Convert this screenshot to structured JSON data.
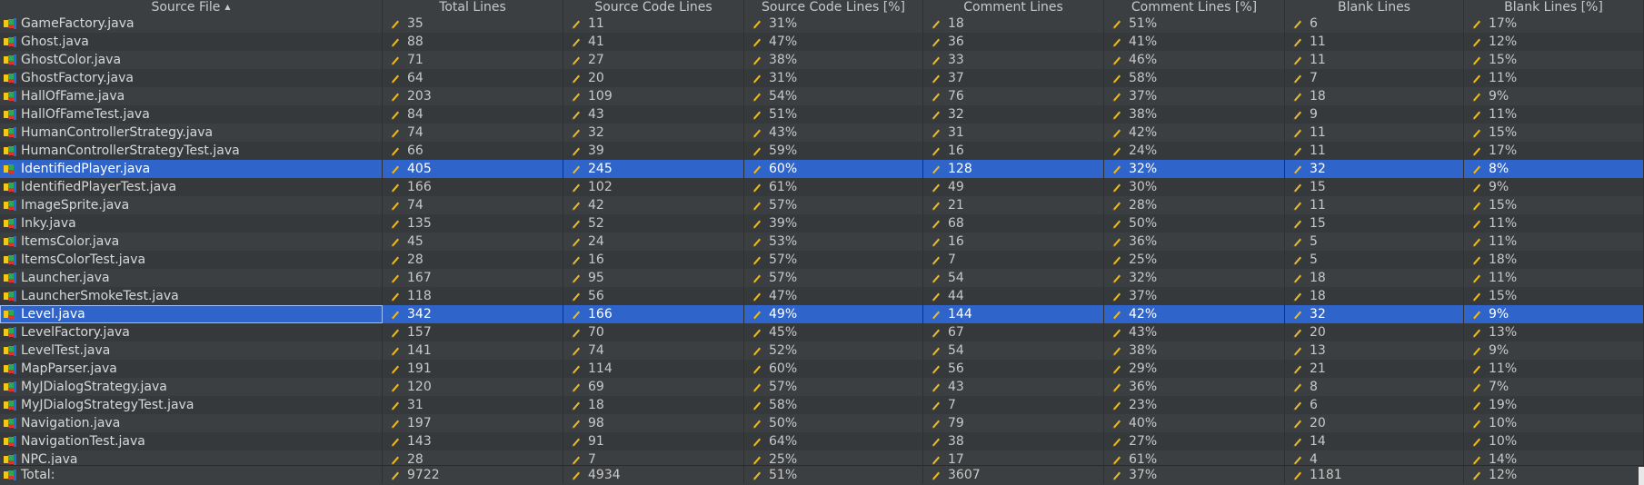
{
  "table": {
    "columns": [
      {
        "label": "Source File",
        "sorted": "asc"
      },
      {
        "label": "Total Lines"
      },
      {
        "label": "Source Code Lines"
      },
      {
        "label": "Source Code Lines [%]"
      },
      {
        "label": "Comment Lines"
      },
      {
        "label": "Comment Lines [%]"
      },
      {
        "label": "Blank Lines"
      },
      {
        "label": "Blank Lines [%]"
      }
    ],
    "sort_indicator": "▲",
    "rows": [
      {
        "file": "GameFactory.java",
        "values": [
          "35",
          "11",
          "31%",
          "18",
          "51%",
          "6",
          "17%"
        ]
      },
      {
        "file": "Ghost.java",
        "values": [
          "88",
          "41",
          "47%",
          "36",
          "41%",
          "11",
          "12%"
        ]
      },
      {
        "file": "GhostColor.java",
        "values": [
          "71",
          "27",
          "38%",
          "33",
          "46%",
          "11",
          "15%"
        ]
      },
      {
        "file": "GhostFactory.java",
        "values": [
          "64",
          "20",
          "31%",
          "37",
          "58%",
          "7",
          "11%"
        ]
      },
      {
        "file": "HallOfFame.java",
        "values": [
          "203",
          "109",
          "54%",
          "76",
          "37%",
          "18",
          "9%"
        ]
      },
      {
        "file": "HallOfFameTest.java",
        "values": [
          "84",
          "43",
          "51%",
          "32",
          "38%",
          "9",
          "11%"
        ]
      },
      {
        "file": "HumanControllerStrategy.java",
        "values": [
          "74",
          "32",
          "43%",
          "31",
          "42%",
          "11",
          "15%"
        ]
      },
      {
        "file": "HumanControllerStrategyTest.java",
        "values": [
          "66",
          "39",
          "59%",
          "16",
          "24%",
          "11",
          "17%"
        ]
      },
      {
        "file": "IdentifiedPlayer.java",
        "values": [
          "405",
          "245",
          "60%",
          "128",
          "32%",
          "32",
          "8%"
        ],
        "selected": true
      },
      {
        "file": "IdentifiedPlayerTest.java",
        "values": [
          "166",
          "102",
          "61%",
          "49",
          "30%",
          "15",
          "9%"
        ]
      },
      {
        "file": "ImageSprite.java",
        "values": [
          "74",
          "42",
          "57%",
          "21",
          "28%",
          "11",
          "15%"
        ]
      },
      {
        "file": "Inky.java",
        "values": [
          "135",
          "52",
          "39%",
          "68",
          "50%",
          "15",
          "11%"
        ]
      },
      {
        "file": "ItemsColor.java",
        "values": [
          "45",
          "24",
          "53%",
          "16",
          "36%",
          "5",
          "11%"
        ]
      },
      {
        "file": "ItemsColorTest.java",
        "values": [
          "28",
          "16",
          "57%",
          "7",
          "25%",
          "5",
          "18%"
        ]
      },
      {
        "file": "Launcher.java",
        "values": [
          "167",
          "95",
          "57%",
          "54",
          "32%",
          "18",
          "11%"
        ]
      },
      {
        "file": "LauncherSmokeTest.java",
        "values": [
          "118",
          "56",
          "47%",
          "44",
          "37%",
          "18",
          "15%"
        ]
      },
      {
        "file": "Level.java",
        "values": [
          "342",
          "166",
          "49%",
          "144",
          "42%",
          "32",
          "9%"
        ],
        "selected": true,
        "focused": true
      },
      {
        "file": "LevelFactory.java",
        "values": [
          "157",
          "70",
          "45%",
          "67",
          "43%",
          "20",
          "13%"
        ]
      },
      {
        "file": "LevelTest.java",
        "values": [
          "141",
          "74",
          "52%",
          "54",
          "38%",
          "13",
          "9%"
        ]
      },
      {
        "file": "MapParser.java",
        "values": [
          "191",
          "114",
          "60%",
          "56",
          "29%",
          "21",
          "11%"
        ]
      },
      {
        "file": "MyJDialogStrategy.java",
        "values": [
          "120",
          "69",
          "57%",
          "43",
          "36%",
          "8",
          "7%"
        ]
      },
      {
        "file": "MyJDialogStrategyTest.java",
        "values": [
          "31",
          "18",
          "58%",
          "7",
          "23%",
          "6",
          "19%"
        ]
      },
      {
        "file": "Navigation.java",
        "values": [
          "197",
          "98",
          "50%",
          "79",
          "40%",
          "20",
          "10%"
        ]
      },
      {
        "file": "NavigationTest.java",
        "values": [
          "143",
          "91",
          "64%",
          "38",
          "27%",
          "14",
          "10%"
        ]
      },
      {
        "file": "NPC.java",
        "values": [
          "28",
          "7",
          "25%",
          "17",
          "61%",
          "4",
          "14%"
        ]
      }
    ],
    "total": {
      "label": "Total:",
      "values": [
        "9722",
        "4934",
        "51%",
        "3607",
        "37%",
        "1181",
        "12%"
      ]
    }
  },
  "icons": {
    "file": "java-file-icon",
    "value": "pencil-icon"
  },
  "colors": {
    "background": "#3c3f41",
    "selection": "#2f65ca",
    "text": "#c8c8c8"
  }
}
